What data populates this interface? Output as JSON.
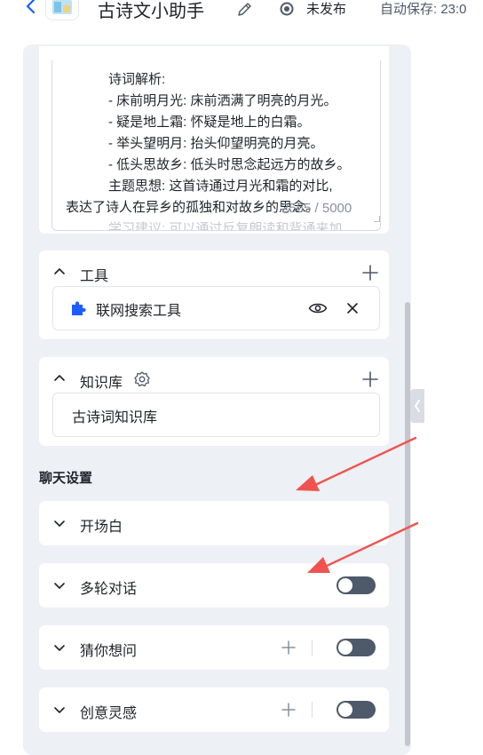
{
  "header": {
    "title": "古诗文小助手",
    "status": "未发布",
    "autosave": "自动保存: 23:0"
  },
  "prompt": {
    "lines": [
      "诗词解析:",
      "- 床前明月光: 床前洒满了明亮的月光。",
      "- 疑是地上霜: 怀疑是地上的白霜。",
      "- 举头望明月: 抬头仰望明亮的月亮。",
      "- 低头思故乡: 低头时思念起远方的故乡。",
      "主题思想: 这首诗通过月光和霜的对比,",
      "表达了诗人在异乡的孤独和对故乡的思念。",
      "学习建议: 可以通过反复朗读和背诵来加"
    ],
    "counter": "2565 / 5000"
  },
  "tools": {
    "title": "工具",
    "item": "联网搜索工具"
  },
  "knowledge": {
    "title": "知识库",
    "item": "古诗词知识库"
  },
  "chat_settings": {
    "label": "聊天设置",
    "sections": [
      {
        "title": "开场白",
        "toggle": false
      },
      {
        "title": "多轮对话",
        "toggle": false
      },
      {
        "title": "猜你想问",
        "toggle": false
      },
      {
        "title": "创意灵感",
        "toggle": false
      }
    ]
  },
  "colors": {
    "accent": "#1d5cff",
    "annotation_arrow": "#f0534f"
  }
}
